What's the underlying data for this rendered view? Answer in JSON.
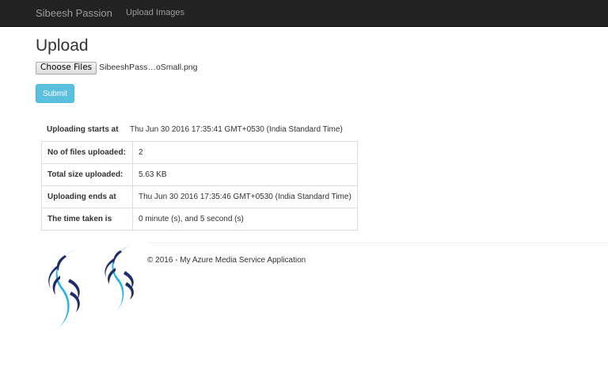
{
  "navbar": {
    "brand": "Sibeesh Passion",
    "links": [
      "Upload Images"
    ]
  },
  "upload": {
    "title": "Upload",
    "choose_files_label": "Choose Files",
    "file_name": "SibeeshPass…oSmall.png",
    "submit_label": "Submit"
  },
  "results": {
    "start": {
      "label": "Uploading starts at",
      "value": "Thu Jun 30 2016 17:35:41 GMT+0530 (India Standard Time)"
    },
    "rows": [
      {
        "label": "No of files uploaded:",
        "value": "2"
      },
      {
        "label": "Total size uploaded:",
        "value": "5.63 KB"
      },
      {
        "label": "Uploading ends at",
        "value": "Thu Jun 30 2016 17:35:46 GMT+0530 (India Standard Time)"
      },
      {
        "label": "The time taken is",
        "value": "0 minute (s), and 5 second (s)"
      }
    ]
  },
  "footer": {
    "copyright": "© 2016 - My Azure Media Service Application",
    "logo_icons": [
      "sibeesh-passion-logo-icon",
      "sibeesh-passion-logo-icon"
    ]
  },
  "colors": {
    "navbar_bg": "#222222",
    "navbar_text": "#9d9d9d",
    "submit_bg": "#5bc0de",
    "logo_navy": "#1f2d6b",
    "logo_cyan": "#29b6e3"
  }
}
